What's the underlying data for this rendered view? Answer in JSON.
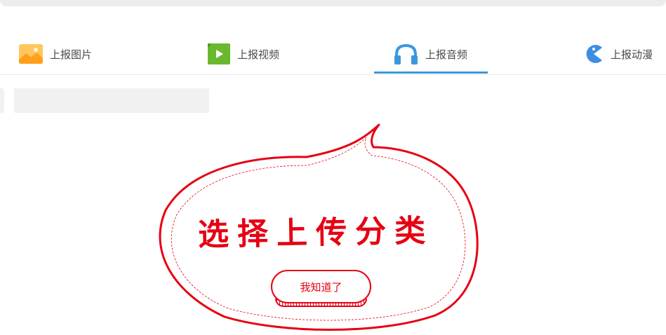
{
  "tabs": [
    {
      "label": "上报图片",
      "icon": "image-icon"
    },
    {
      "label": "上报视频",
      "icon": "video-icon"
    },
    {
      "label": "上报音频",
      "icon": "headphones-icon",
      "active": true
    },
    {
      "label": "上报动漫",
      "icon": "pacman-icon"
    }
  ],
  "guide": {
    "title": "选择上传分类",
    "button_label": "我知道了"
  },
  "colors": {
    "accent": "#3a98dc",
    "guide_red": "#e60012",
    "image_icon": "#ffb84d",
    "video_icon": "#6ab82e",
    "headphones_icon": "#3a98dc",
    "pacman_icon": "#3d8ee0"
  }
}
